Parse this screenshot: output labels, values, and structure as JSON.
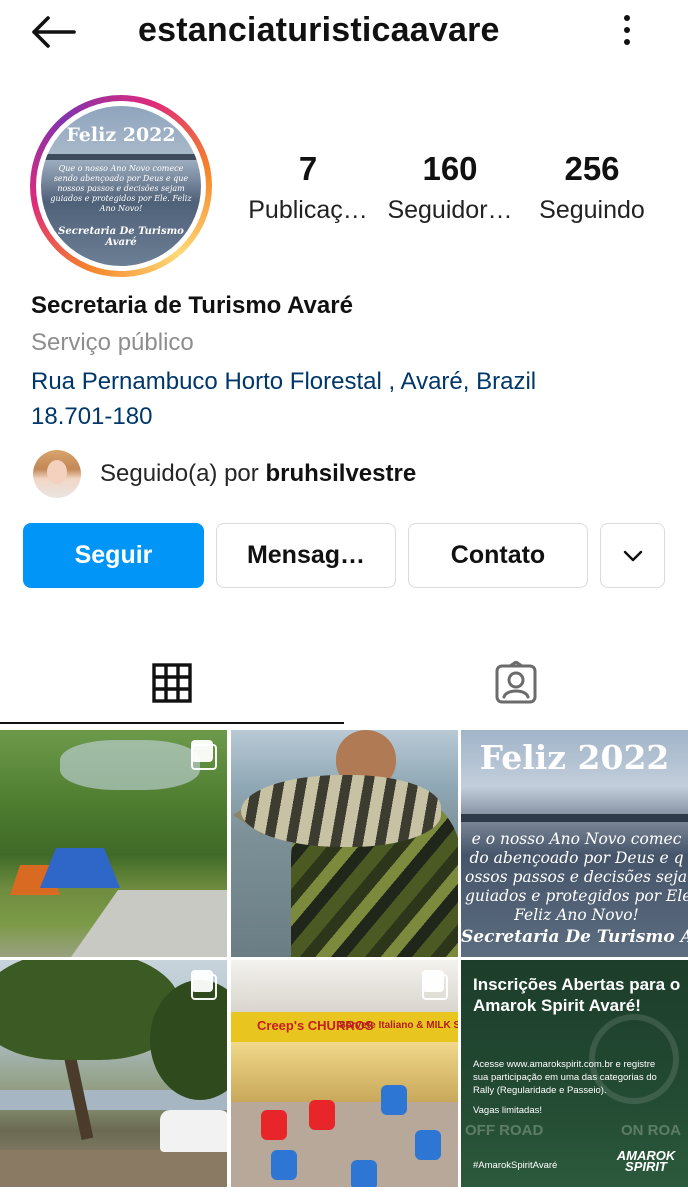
{
  "header": {
    "username": "estanciaturisticaavare"
  },
  "profile": {
    "avatar": {
      "title": "Feliz 2022",
      "message": "Que o nosso Ano Novo comece sendo abençoado por Deus e que nossos passos e decisões sejam guiados e protegidos por Ele. Feliz Ano Novo!",
      "signature": "Secretaria De Turismo Avaré"
    },
    "stats": [
      {
        "value": "7",
        "label": "Publicaç…"
      },
      {
        "value": "160",
        "label": "Seguidor…"
      },
      {
        "value": "256",
        "label": "Seguindo"
      }
    ],
    "name": "Secretaria de Turismo Avaré",
    "category": "Serviço público",
    "address_line1": "Rua Pernambuco Horto Florestal , Avaré, Brazil",
    "address_line2": "18.701-180",
    "followed_by_prefix": "Seguido(a) por ",
    "followed_by_user": "bruhsilvestre"
  },
  "actions": {
    "follow": "Seguir",
    "message": "Mensag…",
    "contact": "Contato"
  },
  "tabs": {
    "active": "grid"
  },
  "posts": {
    "p3": {
      "title": "Feliz 2022",
      "lines": [
        "e o nosso Ano Novo comec",
        "do abençoado por Deus e q",
        "ossos passos e decisões sejam",
        "guiados e protegidos por Ele.",
        "Feliz Ano Novo!"
      ],
      "signature": "Secretaria De Turismo Ava"
    },
    "p5": {
      "sign_left": "Creep's CHURROS",
      "sign_right": "Sorvete Italiano & MILK SHAKE"
    },
    "p6": {
      "headline": "Inscrições Abertas para o Amarok Spirit Avaré!",
      "body": "Acesse www.amarokspirit.com.br e registre sua participação em uma das categorias do Rally (Regularidade e Passeio).",
      "note": "Vagas limitadas!",
      "road_left": "OFF ROAD",
      "road_right": "ON ROA",
      "hashtag": "#AmarokSpiritAvaré",
      "logo": "AMAROK SPIRIT"
    }
  },
  "colors": {
    "primary_button": "#0095f6",
    "link": "#00376b",
    "muted": "#8e8e8e"
  },
  "icons": [
    "back-arrow-icon",
    "more-vertical-icon",
    "chevron-down-icon",
    "grid-icon",
    "tagged-person-icon",
    "multiple-posts-icon"
  ]
}
